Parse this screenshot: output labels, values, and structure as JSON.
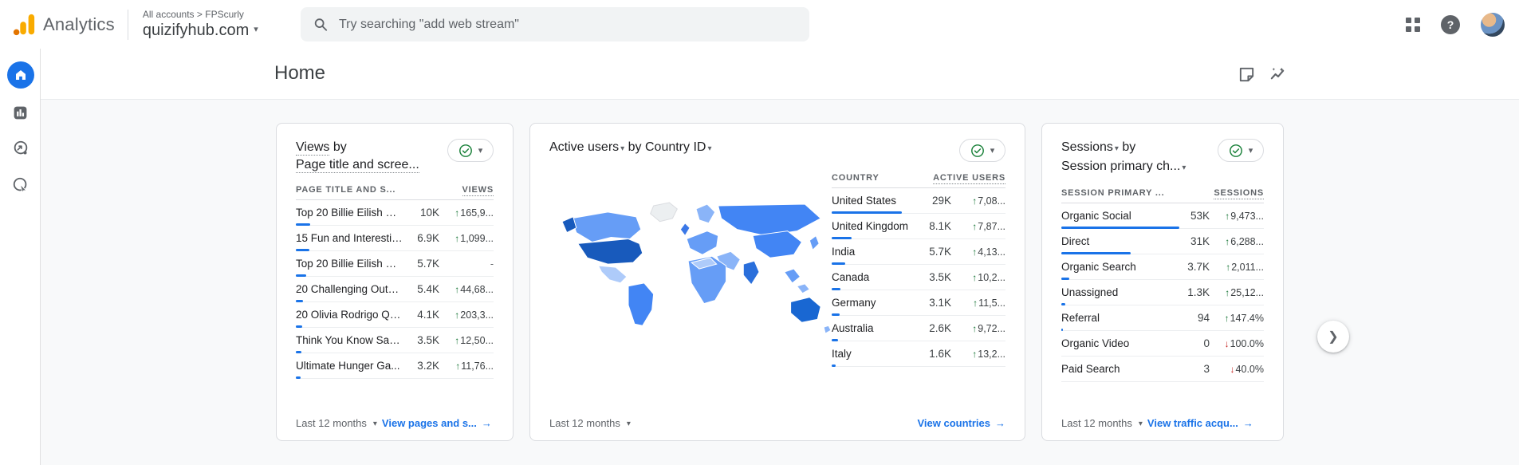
{
  "header": {
    "app_name": "Analytics",
    "breadcrumb_root": "All accounts",
    "breadcrumb_sep": ">",
    "breadcrumb_account": "FPScurly",
    "property_name": "quizifyhub.com",
    "search_placeholder": "Try searching \"add web stream\""
  },
  "glyphs": {
    "caret_down": "▾",
    "arrow_right": "→",
    "chevron_right": "❯",
    "help": "?"
  },
  "page_title": "Home",
  "colors": {
    "accent_blue": "#1a73e8",
    "link_blue": "#1a73e8",
    "up_green": "#137333",
    "down_red": "#c5221f",
    "bar_blue": "#1a73e8"
  },
  "cards": [
    {
      "metric": "Views",
      "conjunction": "by",
      "dimension": "Page title and scree...",
      "col1": "PAGE TITLE AND S...",
      "col2": "VIEWS",
      "rows": [
        {
          "label": "Top 20 Billie Eilish Q...",
          "value": "10K",
          "change": "165,9...",
          "dir": "up",
          "bar": 18
        },
        {
          "label": "15 Fun and Interestin...",
          "value": "6.9K",
          "change": "1,099...",
          "dir": "up",
          "bar": 17
        },
        {
          "label": "Top 20 Billie Eilish Q...",
          "value": "5.7K",
          "change": "-",
          "dir": "none",
          "bar": 13
        },
        {
          "label": "20 Challenging Outer...",
          "value": "5.4K",
          "change": "44,68...",
          "dir": "up",
          "bar": 9
        },
        {
          "label": "20 Olivia Rodrigo Qui...",
          "value": "4.1K",
          "change": "203,3...",
          "dir": "up",
          "bar": 8
        },
        {
          "label": "Think You Know Sabr...",
          "value": "3.5K",
          "change": "12,50...",
          "dir": "up",
          "bar": 7
        },
        {
          "label": "Ultimate Hunger Ga...",
          "value": "3.2K",
          "change": "11,76...",
          "dir": "up",
          "bar": 6
        }
      ],
      "period": "Last 12 months",
      "link": "View pages and s..."
    },
    {
      "metric": "Active users",
      "conjunction": "by",
      "dimension": "Country ID",
      "col1": "COUNTRY",
      "col2": "ACTIVE USERS",
      "rows": [
        {
          "label": "United States",
          "value": "29K",
          "change": "7,08...",
          "dir": "up",
          "bar": 88
        },
        {
          "label": "United Kingdom",
          "value": "8.1K",
          "change": "7,87...",
          "dir": "up",
          "bar": 25
        },
        {
          "label": "India",
          "value": "5.7K",
          "change": "4,13...",
          "dir": "up",
          "bar": 17
        },
        {
          "label": "Canada",
          "value": "3.5K",
          "change": "10,2...",
          "dir": "up",
          "bar": 11
        },
        {
          "label": "Germany",
          "value": "3.1K",
          "change": "11,5...",
          "dir": "up",
          "bar": 10
        },
        {
          "label": "Australia",
          "value": "2.6K",
          "change": "9,72...",
          "dir": "up",
          "bar": 8
        },
        {
          "label": "Italy",
          "value": "1.6K",
          "change": "13,2...",
          "dir": "up",
          "bar": 5
        }
      ],
      "period": "Last 12 months",
      "link": "View countries"
    },
    {
      "metric": "Sessions",
      "conjunction": "by",
      "dimension": "Session primary ch...",
      "col1": "SESSION PRIMARY ...",
      "col2": "SESSIONS",
      "rows": [
        {
          "label": "Organic Social",
          "value": "53K",
          "change": "9,473...",
          "dir": "up",
          "bar": 148
        },
        {
          "label": "Direct",
          "value": "31K",
          "change": "6,288...",
          "dir": "up",
          "bar": 87
        },
        {
          "label": "Organic Search",
          "value": "3.7K",
          "change": "2,011...",
          "dir": "up",
          "bar": 10
        },
        {
          "label": "Unassigned",
          "value": "1.3K",
          "change": "25,12...",
          "dir": "up",
          "bar": 5
        },
        {
          "label": "Referral",
          "value": "94",
          "change": "147.4%",
          "dir": "up",
          "bar": 2
        },
        {
          "label": "Organic Video",
          "value": "0",
          "change": "100.0%",
          "dir": "down",
          "bar": 0
        },
        {
          "label": "Paid Search",
          "value": "3",
          "change": "40.0%",
          "dir": "down",
          "bar": 0
        }
      ],
      "period": "Last 12 months",
      "link": "View traffic acqu..."
    }
  ],
  "map": {
    "regions": {
      "greenland": "#eceff1",
      "canada": "#669df6",
      "alaska": "#185abc",
      "usa": "#185abc",
      "mexico": "#aecbfa",
      "samerica": "#4285f4",
      "uk": "#3b78e7",
      "scandinavia": "#8ab4f8",
      "europe": "#669df6",
      "russia": "#4285f4",
      "mideast": "#8ab4f8",
      "africa": "#669df6",
      "africa_north": "#aecbfa",
      "india": "#2a6fdb",
      "eastasia": "#4285f4",
      "seasia": "#669df6",
      "indonesia": "#8ab4f8",
      "japan": "#669df6",
      "australia": "#1967d2",
      "nz": "#8ab4f8"
    }
  }
}
